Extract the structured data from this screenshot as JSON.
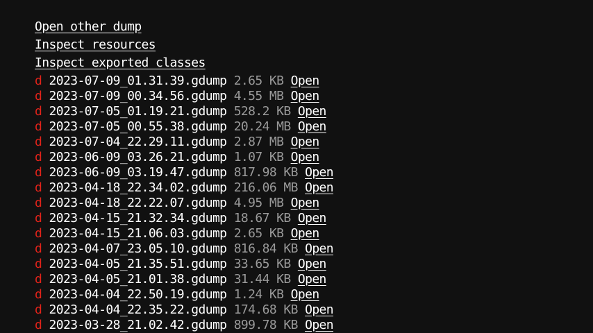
{
  "links": {
    "open_other_dump": "Open other dump",
    "inspect_resources": "Inspect resources",
    "inspect_exported_classes": "Inspect exported classes"
  },
  "list": {
    "marker": "d",
    "open_label": "Open",
    "marker_color": "#e2231a",
    "size_color": "#9a9a9a",
    "items": [
      {
        "name": "2023-07-09_01.31.39.gdump",
        "size": "2.65 KB"
      },
      {
        "name": "2023-07-09_00.34.56.gdump",
        "size": "4.55 MB"
      },
      {
        "name": "2023-07-05_01.19.21.gdump",
        "size": "528.2 KB"
      },
      {
        "name": "2023-07-05_00.55.38.gdump",
        "size": "20.24 MB"
      },
      {
        "name": "2023-07-04_22.29.11.gdump",
        "size": "2.87 MB"
      },
      {
        "name": "2023-06-09_03.26.21.gdump",
        "size": "1.07 KB"
      },
      {
        "name": "2023-06-09_03.19.47.gdump",
        "size": "817.98 KB"
      },
      {
        "name": "2023-04-18_22.34.02.gdump",
        "size": "216.06 MB"
      },
      {
        "name": "2023-04-18_22.22.07.gdump",
        "size": "4.95 MB"
      },
      {
        "name": "2023-04-15_21.32.34.gdump",
        "size": "18.67 KB"
      },
      {
        "name": "2023-04-15_21.06.03.gdump",
        "size": "2.65 KB"
      },
      {
        "name": "2023-04-07_23.05.10.gdump",
        "size": "816.84 KB"
      },
      {
        "name": "2023-04-05_21.35.51.gdump",
        "size": "33.65 KB"
      },
      {
        "name": "2023-04-05_21.01.38.gdump",
        "size": "31.44 KB"
      },
      {
        "name": "2023-04-04_22.50.19.gdump",
        "size": "1.24 KB"
      },
      {
        "name": "2023-04-04_22.35.22.gdump",
        "size": "174.68 KB"
      },
      {
        "name": "2023-03-28_21.02.42.gdump",
        "size": "899.78 KB"
      }
    ]
  }
}
